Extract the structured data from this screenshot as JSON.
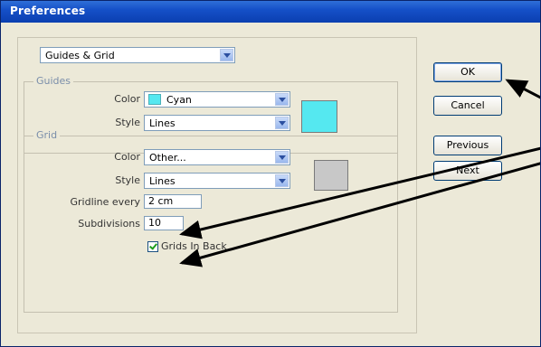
{
  "window": {
    "title": "Preferences"
  },
  "category_select": {
    "value": "Guides & Grid"
  },
  "guides": {
    "legend": "Guides",
    "color_label": "Color",
    "color_value": "Cyan",
    "color_hex": "#55e8f0",
    "style_label": "Style",
    "style_value": "Lines"
  },
  "grid": {
    "legend": "Grid",
    "color_label": "Color",
    "color_value": "Other...",
    "color_hex": "#c8c8c8",
    "style_label": "Style",
    "style_value": "Lines",
    "gridline_label": "Gridline every",
    "gridline_value": "2 cm",
    "subdivisions_label": "Subdivisions",
    "subdivisions_value": "10",
    "grids_in_back_label": "Grids In Back",
    "grids_in_back_checked": true
  },
  "buttons": {
    "ok": "OK",
    "cancel": "Cancel",
    "previous": "Previous",
    "next": "Next"
  }
}
